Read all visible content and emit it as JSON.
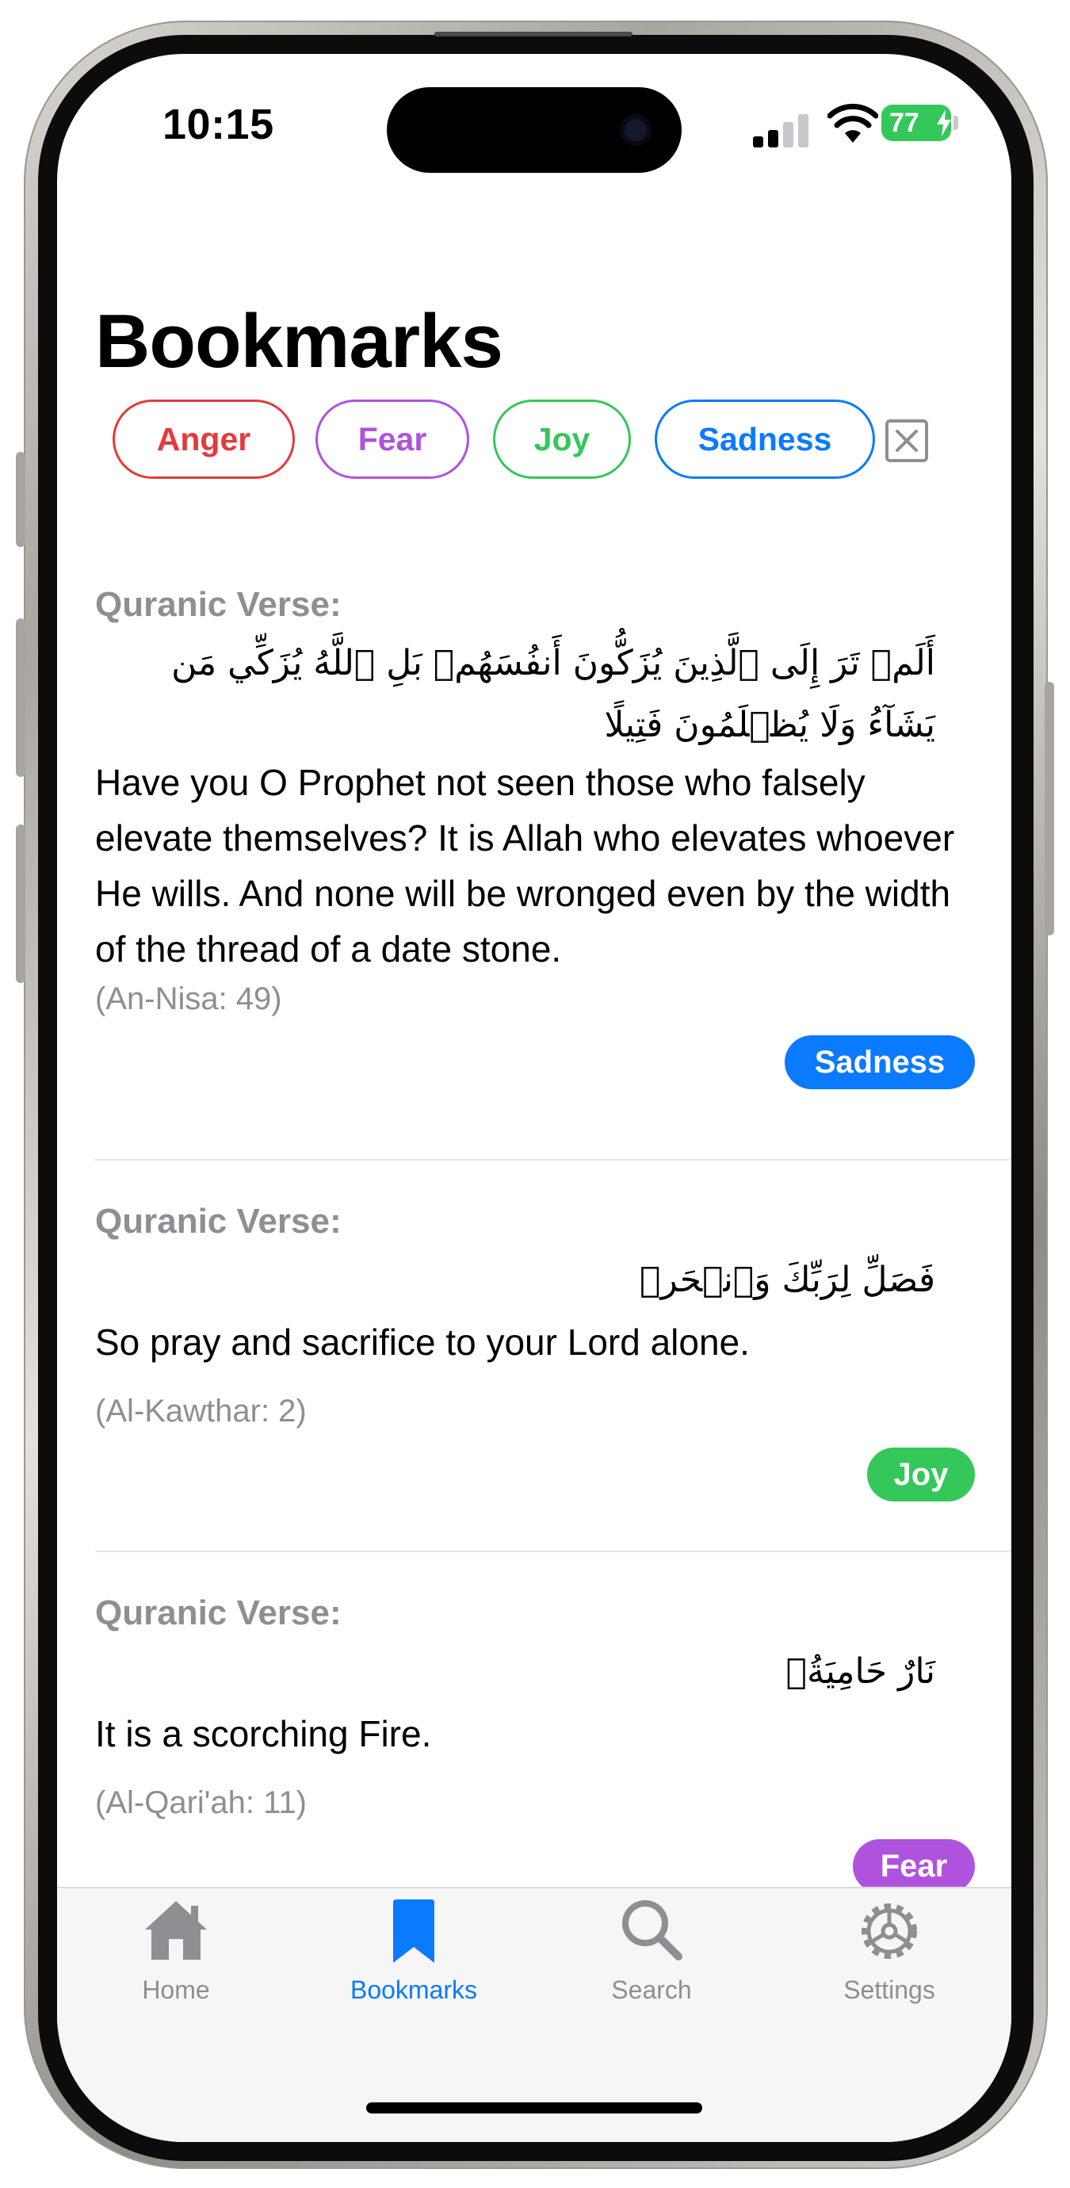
{
  "status_bar": {
    "time": "10:15",
    "battery": "77"
  },
  "page": {
    "title": "Bookmarks"
  },
  "filters": {
    "chips": [
      {
        "label": "Anger",
        "color": "#e5393b"
      },
      {
        "label": "Fear",
        "color": "#af52de"
      },
      {
        "label": "Joy",
        "color": "#34c759"
      },
      {
        "label": "Sadness",
        "color": "#0a7aff"
      }
    ],
    "clear_icon": "close-square-icon"
  },
  "entries": [
    {
      "label": "Quranic Verse:",
      "arabic": "أَلَمۡ تَرَ إِلَى ٱلَّذِينَ يُزَكُّونَ أَنفُسَهُمۚ بَلِ ٱللَّهُ يُزَكِّي مَن يَشَآءُ وَلَا يُظۡلَمُونَ فَتِيلًا",
      "translation": "Have you O Prophet not seen those who falsely elevate themselves? It is Allah who elevates whoever He wills. And none will be wronged even by the width of the thread of a date stone.",
      "reference": "(An-Nisa: 49)",
      "tag": "Sadness",
      "tag_color": "#0a7aff"
    },
    {
      "label": "Quranic Verse:",
      "arabic": "فَصَلِّ لِرَبِّكَ وَٱنۡحَرۡ",
      "translation": "So pray and sacrifice to your Lord alone.",
      "reference": "(Al-Kawthar: 2)",
      "tag": "Joy",
      "tag_color": "#34c759"
    },
    {
      "label": "Quranic Verse:",
      "arabic": "نَارٌ حَامِيَةُۢ",
      "translation": "It is a scorching Fire.",
      "reference": "(Al-Qari'ah: 11)",
      "tag": "Fear",
      "tag_color": "#af52de"
    }
  ],
  "tab_bar": {
    "active_color": "#0a7aff",
    "inactive_color": "#8e8e93",
    "tabs": [
      {
        "label": "Home",
        "icon": "house-icon"
      },
      {
        "label": "Bookmarks",
        "icon": "bookmark-icon",
        "active": true
      },
      {
        "label": "Search",
        "icon": "magnifier-icon"
      },
      {
        "label": "Settings",
        "icon": "gear-icon"
      }
    ]
  }
}
